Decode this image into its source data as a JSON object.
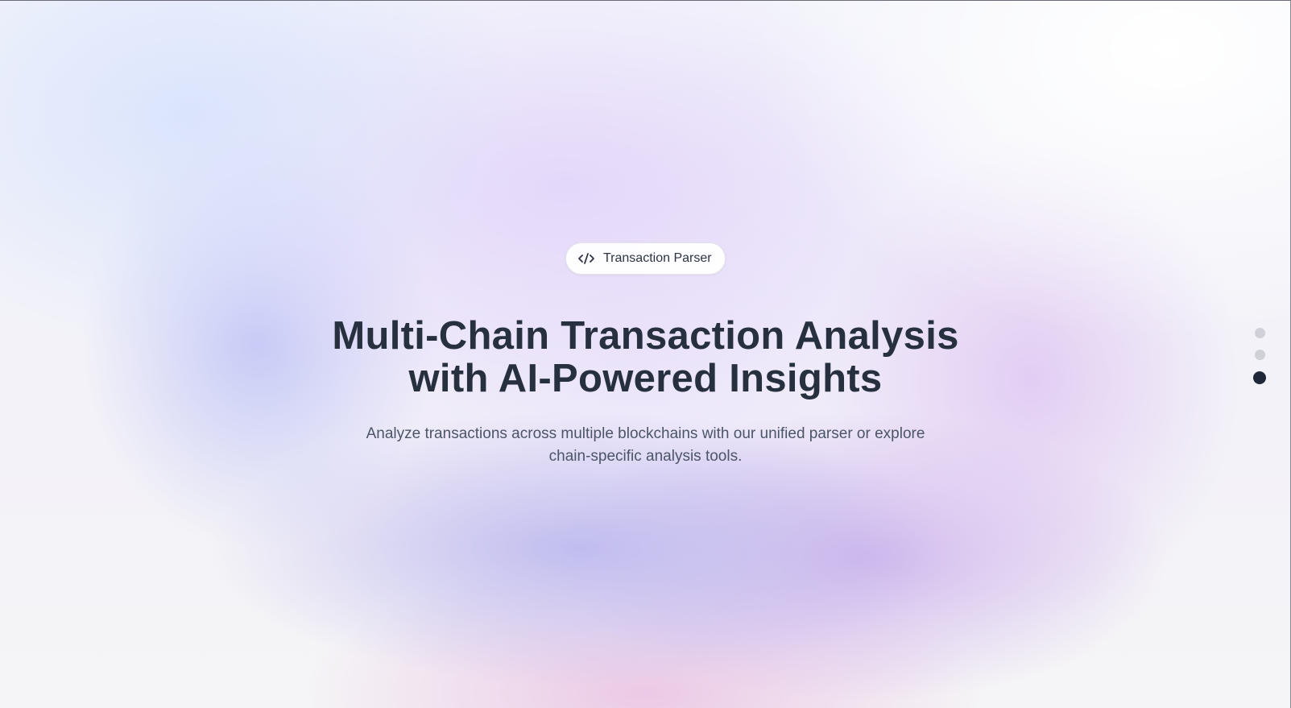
{
  "hero": {
    "badge": {
      "label": "Transaction Parser",
      "icon": "code-icon"
    },
    "title_line_1": "Multi-Chain Transaction Analysis",
    "title_line_2": "with AI-Powered Insights",
    "subtitle_line_1": "Analyze transactions across multiple blockchains with our unified parser or explore",
    "subtitle_line_2": "chain-specific analysis tools."
  },
  "pagination": {
    "total": 3,
    "active_index": 3
  },
  "colors": {
    "heading": "#27303f",
    "body_text": "#4c5568",
    "active_dot": "#1f2838",
    "inactive_dot": "#cfd0d8"
  }
}
